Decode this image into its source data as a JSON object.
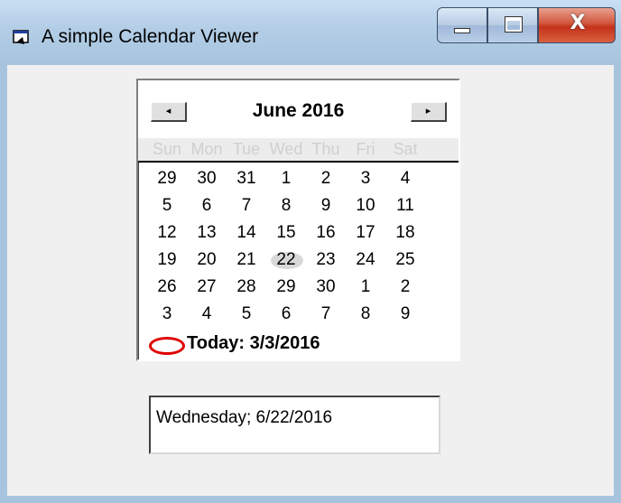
{
  "window": {
    "title": "A simple Calendar Viewer",
    "title_icon": "app-window-icon"
  },
  "titlebar_buttons": {
    "minimize_icon": "minimize-icon",
    "maximize_icon": "maximize-icon",
    "close_label": "X"
  },
  "calendar": {
    "prev_glyph": "◂",
    "next_glyph": "▸",
    "month_title": "June 2016",
    "weekdays": [
      "Sun",
      "Mon",
      "Tue",
      "Wed",
      "Thu",
      "Fri",
      "Sat"
    ],
    "weeks": [
      [
        "29",
        "30",
        "31",
        "1",
        "2",
        "3",
        "4"
      ],
      [
        "5",
        "6",
        "7",
        "8",
        "9",
        "10",
        "11"
      ],
      [
        "12",
        "13",
        "14",
        "15",
        "16",
        "17",
        "18"
      ],
      [
        "19",
        "20",
        "21",
        "22",
        "23",
        "24",
        "25"
      ],
      [
        "26",
        "27",
        "28",
        "29",
        "30",
        "1",
        "2"
      ],
      [
        "3",
        "4",
        "5",
        "6",
        "7",
        "8",
        "9"
      ]
    ],
    "selected_day": "22",
    "today_label": "Today: 3/3/2016",
    "today_marker_color": "#e00000"
  },
  "output": {
    "value": "Wednesday; 6/22/2016"
  }
}
